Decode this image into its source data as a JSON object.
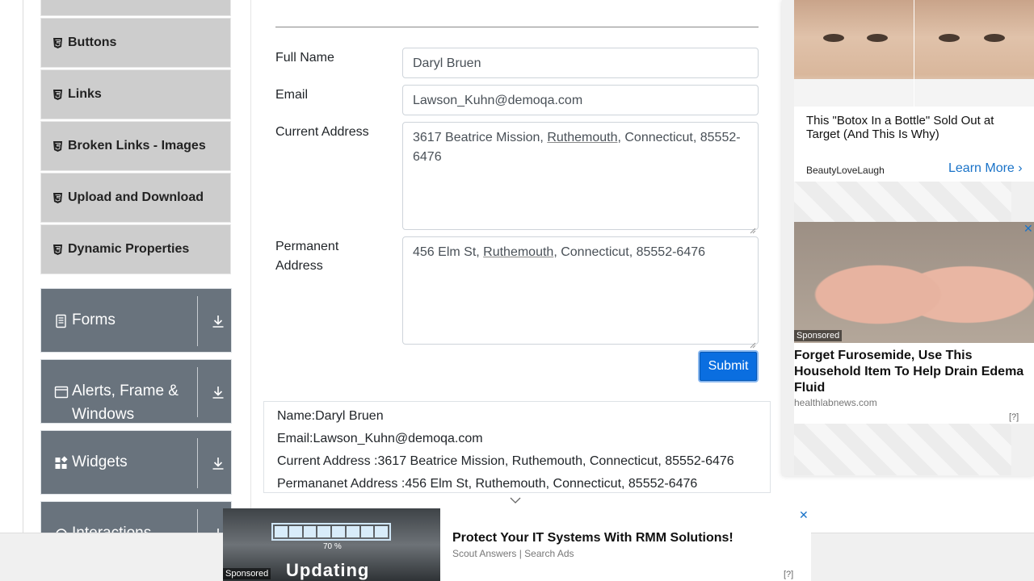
{
  "sidebar": {
    "elements_items": [
      {
        "label": "Buttons"
      },
      {
        "label": "Links"
      },
      {
        "label": "Broken Links - Images"
      },
      {
        "label": "Upload and Download"
      },
      {
        "label": "Dynamic Properties"
      }
    ],
    "groups": [
      {
        "label": "Forms",
        "icon": "form-icon"
      },
      {
        "label": "Alerts, Frame & Windows",
        "icon": "window-icon"
      },
      {
        "label": "Widgets",
        "icon": "widgets-icon"
      },
      {
        "label": "Interactions",
        "icon": "interactions-icon"
      }
    ]
  },
  "form": {
    "full_name_label": "Full Name",
    "full_name_value": "Daryl Bruen",
    "email_label": "Email",
    "email_value": "Lawson_Kuhn@demoqa.com",
    "current_address_label": "Current Address",
    "current_address_value": [
      "3617 Beatrice Mission, ",
      "Ruthemouth",
      ", Connecticut, 85552-6476"
    ],
    "permanent_address_label": "Permanent Address",
    "permanent_address_value": [
      "456 Elm St, ",
      "Ruthemouth",
      ", Connecticut, 85552-6476"
    ],
    "submit_label": "Submit"
  },
  "output": {
    "name": "Name:Daryl Bruen",
    "email": "Email:Lawson_Kuhn@demoqa.com",
    "current_address": "Current Address :3617 Beatrice Mission, Ruthemouth, Connecticut, 85552-6476",
    "permanent_address": "Permananet Address :456 Elm St, Ruthemouth, Connecticut, 85552-6476"
  },
  "ads": {
    "ad1": {
      "headline": "This \"Botox In a Bottle\" Sold Out at Target (And This Is Why)",
      "source": "BeautyLoveLaugh",
      "cta": "Learn More"
    },
    "ad2": {
      "sponsored": "Sponsored",
      "headline": "Forget Furosemide, Use This Household Item To Help Drain Edema Fluid",
      "source": "healthlabnews.com",
      "help": "[?]"
    },
    "bottom": {
      "sponsored": "Sponsored",
      "image_text": "Updating",
      "percent": "70 %",
      "headline": "Protect Your IT Systems With RMM Solutions!",
      "source": "Scout Answers | Search Ads",
      "help": "[?]"
    }
  },
  "colors": {
    "accent": "#007bff",
    "sidebar_group": "#69737d",
    "sidebar_item": "#cdcdcd"
  }
}
